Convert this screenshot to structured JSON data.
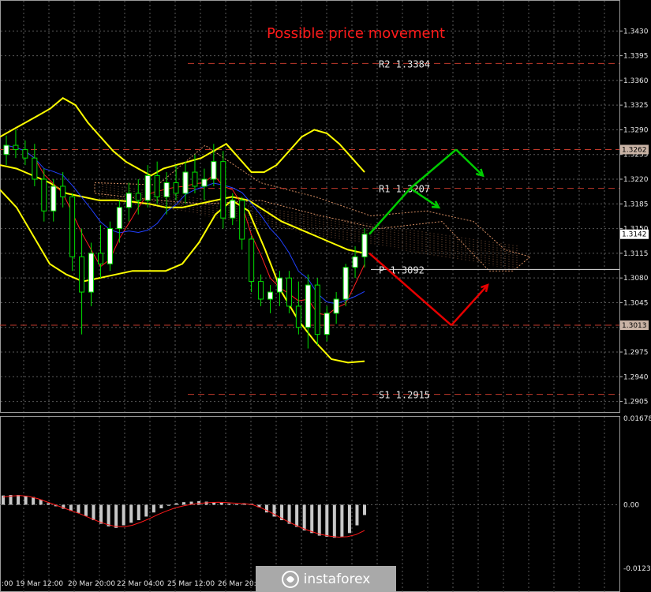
{
  "chart_data": [
    {
      "type": "line",
      "title": "Possible price movement",
      "instrument_note": "",
      "y_axis": {
        "ylim": [
          1.289,
          1.3465
        ],
        "tick_labels": [
          "1.3430",
          "1.3395",
          "1.3360",
          "1.3325",
          "1.3290",
          "1.3255",
          "1.3220",
          "1.3185",
          "1.3150",
          "1.3115",
          "1.3080",
          "1.3045",
          "1.3010",
          "1.2975",
          "1.2940",
          "1.2905"
        ],
        "price_marks": [
          {
            "label": "1.3262",
            "value": 1.3262,
            "color": "#d9d9d9"
          },
          {
            "label": "1.3142",
            "value": 1.3142,
            "color": "#ffffff"
          },
          {
            "label": "1.3013",
            "value": 1.3013,
            "color": "#d9d9d9"
          }
        ]
      },
      "x_axis": {
        "tick_labels": [
          ":00",
          "19 Mar 12:00",
          "20 Mar 20:00",
          "22 Mar 04:00",
          "25 Mar 12:00",
          "26 Mar 20:0"
        ]
      },
      "levels": [
        {
          "name": "R2",
          "label": "R2 1.3384",
          "value": 1.3384,
          "color": "#c0392b"
        },
        {
          "name": "R1",
          "label": "R1 1.3207",
          "value": 1.3207,
          "color": "#c0392b"
        },
        {
          "name": "P",
          "label": "P  1.3092",
          "value": 1.3092,
          "color": "#e6e6e6"
        },
        {
          "name": "S1",
          "label": "S1 1.2915",
          "value": 1.2915,
          "color": "#c0392b"
        },
        {
          "name": "support-line",
          "label": "",
          "value": 1.3013,
          "color": "#c0392b"
        },
        {
          "name": "resistance-line",
          "label": "",
          "value": 1.3262,
          "color": "#c0392b"
        }
      ],
      "candles": [
        {
          "o": 1.3255,
          "h": 1.3282,
          "l": 1.324,
          "c": 1.3268
        },
        {
          "o": 1.3268,
          "h": 1.329,
          "l": 1.325,
          "c": 1.3262
        },
        {
          "o": 1.3262,
          "h": 1.3275,
          "l": 1.324,
          "c": 1.325
        },
        {
          "o": 1.325,
          "h": 1.327,
          "l": 1.321,
          "c": 1.322
        },
        {
          "o": 1.322,
          "h": 1.3235,
          "l": 1.316,
          "c": 1.3175
        },
        {
          "o": 1.3175,
          "h": 1.322,
          "l": 1.316,
          "c": 1.321
        },
        {
          "o": 1.321,
          "h": 1.323,
          "l": 1.318,
          "c": 1.3195
        },
        {
          "o": 1.3195,
          "h": 1.32,
          "l": 1.309,
          "c": 1.311
        },
        {
          "o": 1.311,
          "h": 1.315,
          "l": 1.3,
          "c": 1.306
        },
        {
          "o": 1.306,
          "h": 1.313,
          "l": 1.304,
          "c": 1.3115
        },
        {
          "o": 1.3115,
          "h": 1.3155,
          "l": 1.308,
          "c": 1.31
        },
        {
          "o": 1.31,
          "h": 1.316,
          "l": 1.309,
          "c": 1.315
        },
        {
          "o": 1.315,
          "h": 1.319,
          "l": 1.313,
          "c": 1.318
        },
        {
          "o": 1.318,
          "h": 1.3215,
          "l": 1.316,
          "c": 1.32
        },
        {
          "o": 1.32,
          "h": 1.322,
          "l": 1.317,
          "c": 1.319
        },
        {
          "o": 1.319,
          "h": 1.324,
          "l": 1.318,
          "c": 1.3225
        },
        {
          "o": 1.3225,
          "h": 1.3245,
          "l": 1.3185,
          "c": 1.3195
        },
        {
          "o": 1.3195,
          "h": 1.323,
          "l": 1.317,
          "c": 1.3215
        },
        {
          "o": 1.3215,
          "h": 1.324,
          "l": 1.319,
          "c": 1.32
        },
        {
          "o": 1.32,
          "h": 1.3245,
          "l": 1.3185,
          "c": 1.323
        },
        {
          "o": 1.323,
          "h": 1.3255,
          "l": 1.32,
          "c": 1.321
        },
        {
          "o": 1.321,
          "h": 1.3235,
          "l": 1.319,
          "c": 1.322
        },
        {
          "o": 1.322,
          "h": 1.327,
          "l": 1.321,
          "c": 1.3245
        },
        {
          "o": 1.3245,
          "h": 1.326,
          "l": 1.315,
          "c": 1.3165
        },
        {
          "o": 1.3165,
          "h": 1.32,
          "l": 1.3155,
          "c": 1.319
        },
        {
          "o": 1.319,
          "h": 1.3195,
          "l": 1.312,
          "c": 1.3135
        },
        {
          "o": 1.3135,
          "h": 1.314,
          "l": 1.306,
          "c": 1.3075
        },
        {
          "o": 1.3075,
          "h": 1.3085,
          "l": 1.304,
          "c": 1.305
        },
        {
          "o": 1.305,
          "h": 1.307,
          "l": 1.303,
          "c": 1.306
        },
        {
          "o": 1.306,
          "h": 1.309,
          "l": 1.304,
          "c": 1.308
        },
        {
          "o": 1.308,
          "h": 1.309,
          "l": 1.303,
          "c": 1.304
        },
        {
          "o": 1.304,
          "h": 1.3075,
          "l": 1.3,
          "c": 1.301
        },
        {
          "o": 1.301,
          "h": 1.3085,
          "l": 1.298,
          "c": 1.307
        },
        {
          "o": 1.307,
          "h": 1.308,
          "l": 1.2985,
          "c": 1.3
        },
        {
          "o": 1.3,
          "h": 1.304,
          "l": 1.299,
          "c": 1.303
        },
        {
          "o": 1.303,
          "h": 1.306,
          "l": 1.3015,
          "c": 1.305
        },
        {
          "o": 1.305,
          "h": 1.31,
          "l": 1.304,
          "c": 1.3095
        },
        {
          "o": 1.3095,
          "h": 1.3125,
          "l": 1.308,
          "c": 1.311
        },
        {
          "o": 1.311,
          "h": 1.315,
          "l": 1.3095,
          "c": 1.3142
        }
      ],
      "bollinger_upper": [
        1.328,
        1.329,
        1.33,
        1.331,
        1.332,
        1.3335,
        1.3325,
        1.33,
        1.328,
        1.326,
        1.3245,
        1.3235,
        1.3225,
        1.3235,
        1.324,
        1.3245,
        1.325,
        1.326,
        1.327,
        1.325,
        1.323,
        1.323,
        1.324,
        1.326,
        1.328,
        1.329,
        1.3285,
        1.327,
        1.325,
        1.323
      ],
      "bollinger_mid": [
        1.324,
        1.3235,
        1.3225,
        1.3215,
        1.32,
        1.3195,
        1.319,
        1.319,
        1.3188,
        1.3185,
        1.318,
        1.318,
        1.3185,
        1.319,
        1.3195,
        1.319,
        1.3175,
        1.316,
        1.315,
        1.314,
        1.313,
        1.312,
        1.3115
      ],
      "bollinger_lower": [
        1.3205,
        1.318,
        1.314,
        1.31,
        1.3085,
        1.3075,
        1.308,
        1.3085,
        1.309,
        1.309,
        1.309,
        1.31,
        1.313,
        1.317,
        1.319,
        1.3175,
        1.312,
        1.306,
        1.302,
        1.299,
        1.2965,
        1.296,
        1.2962
      ],
      "scenarios": [
        {
          "name": "bullish",
          "color": "#00cc00",
          "points": [
            [
              1.3142,
              0
            ],
            [
              1.3207,
              1
            ],
            [
              1.3262,
              2
            ],
            [
              1.3225,
              3
            ]
          ],
          "side_arrow": [
            [
              1.3207,
              1
            ],
            [
              1.318,
              1.4
            ]
          ]
        },
        {
          "name": "bearish",
          "color": "#e60000",
          "points": [
            [
              1.3115,
              0
            ],
            [
              1.3013,
              1
            ],
            [
              1.307,
              2
            ]
          ]
        }
      ]
    },
    {
      "type": "bar",
      "title": "",
      "y_axis": {
        "tick_labels": [
          "0.01678",
          "0.00",
          "-0.01235"
        ],
        "ylim": [
          -0.01235,
          0.01678
        ]
      },
      "histogram": [
        0.0018,
        0.0019,
        0.0019,
        0.0017,
        0.0015,
        0.001,
        0.0003,
        -0.0003,
        -0.0008,
        -0.0012,
        -0.0016,
        -0.0022,
        -0.003,
        -0.0037,
        -0.0042,
        -0.0045,
        -0.004,
        -0.0035,
        -0.003,
        -0.0023,
        -0.0015,
        -0.0007,
        -0.0002,
        0.0003,
        0.0005,
        0.0006,
        0.0007,
        0.0006,
        0.0005,
        0.0004,
        0.0002,
        0.0001,
        0.0003,
        0.0002,
        -0.0005,
        -0.0015,
        -0.0023,
        -0.003,
        -0.0037,
        -0.0043,
        -0.005,
        -0.0055,
        -0.006,
        -0.0062,
        -0.0064,
        -0.0062,
        -0.0055,
        -0.004,
        -0.002
      ],
      "signal": [
        0.0015,
        0.0017,
        0.0018,
        0.0016,
        0.0012,
        0.0006,
        0.0,
        -0.0006,
        -0.0012,
        -0.0018,
        -0.0025,
        -0.0032,
        -0.0038,
        -0.0042,
        -0.0043,
        -0.004,
        -0.0034,
        -0.0027,
        -0.0019,
        -0.0012,
        -0.0006,
        -0.0002,
        0.0001,
        0.0003,
        0.0004,
        0.0005,
        0.0004,
        0.0003,
        0.0002,
        0.0,
        -0.0006,
        -0.0014,
        -0.0023,
        -0.0032,
        -0.004,
        -0.0047,
        -0.0053,
        -0.0058,
        -0.0061,
        -0.0063,
        -0.0062,
        -0.0058,
        -0.005
      ]
    }
  ],
  "branding": {
    "logo_text": "instaforex",
    "logo_icon": "instaforex-swirl-icon"
  }
}
